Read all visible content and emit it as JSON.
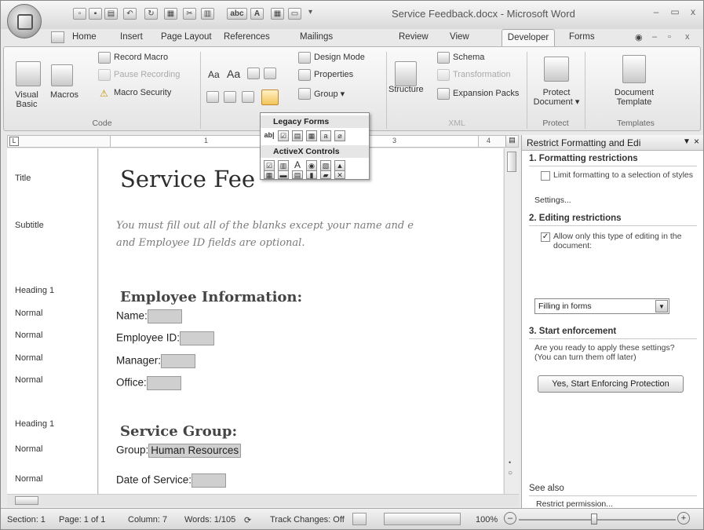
{
  "window": {
    "title": "Service Feedback.docx - Microsoft Word",
    "min": "–",
    "max": "▭",
    "close": "x"
  },
  "quick_access": [
    "save",
    "undo",
    "redo",
    "print-preview",
    "spelling"
  ],
  "tabs": [
    "Home",
    "Insert",
    "Page Layout",
    "References",
    "Mailings",
    "Review",
    "View",
    "Developer",
    "Forms"
  ],
  "ribbon": {
    "code": {
      "visual_basic": "Visual Basic",
      "macros": "Macros",
      "record_macro": "Record Macro",
      "pause_recording": "Pause Recording",
      "macro_security": "Macro Security",
      "label": "Code"
    },
    "controls": {
      "design_mode": "Design Mode",
      "properties": "Properties",
      "group": "Group ▾",
      "aa1": "Aa",
      "aa2": "Aa"
    },
    "xml": {
      "structure": "Structure",
      "schema": "Schema",
      "transformation": "Transformation",
      "expansion_packs": "Expansion Packs",
      "label": "XML"
    },
    "protect": {
      "protect_document": "Protect Document ▾",
      "label": "Protect"
    },
    "templates": {
      "document_template": "Document Template",
      "label": "Templates"
    }
  },
  "legacy_popup": {
    "legacy_title": "Legacy Forms",
    "activex_title": "ActiveX Controls",
    "legacy_icons": [
      "ab|",
      "☑",
      "▤",
      "▦",
      "a",
      "⌀"
    ],
    "activex_icons": [
      "☑",
      "▥",
      "A",
      "◉",
      "▧",
      "▲",
      "▦",
      "▬",
      "▤",
      "▮",
      "▰",
      "✕"
    ]
  },
  "styles": [
    "Title",
    "Subtitle",
    "Heading 1",
    "Normal",
    "Normal",
    "Normal",
    "Normal",
    "Heading 1",
    "Normal",
    "Normal"
  ],
  "document": {
    "title": "Service Fee",
    "subtitle_line1": "You must fill out all of the blanks except your name and e",
    "subtitle_line2": "and Employee ID fields are optional.",
    "heading1": "Employee Information:",
    "name": "Name:",
    "employee_id": "Employee ID:",
    "manager": "Manager:",
    "office": "Office:",
    "heading2": "Service Group:",
    "group": "Group:",
    "group_value": "Human Resources",
    "date": "Date of Service:"
  },
  "pane": {
    "title": "Restrict Formatting and Edi",
    "s1": "1. Formatting restrictions",
    "limit_formatting": "Limit formatting to a selection of styles",
    "settings": "Settings...",
    "s2": "2. Editing restrictions",
    "allow_only": "Allow only this type of editing in the document:",
    "editing_type": "Filling in forms",
    "s3": "3. Start enforcement",
    "ready": "Are you ready to apply these settings? (You can turn them off later)",
    "enforce_button": "Yes, Start Enforcing Protection",
    "see_also": "See also",
    "restrict_permission": "Restrict permission..."
  },
  "status": {
    "section": "Section: 1",
    "page": "Page: 1 of 1",
    "column": "Column: 7",
    "words": "Words: 1/105",
    "track": "Track Changes: Off",
    "zoom": "100%"
  }
}
